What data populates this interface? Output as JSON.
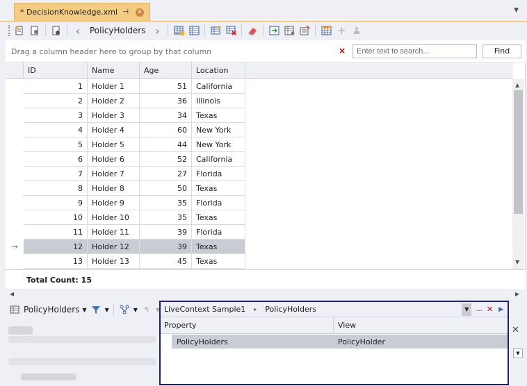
{
  "tab": {
    "title": "* DecisionKnowledge.xml",
    "pin": "⊣",
    "close": "✕",
    "dropdown": "▼"
  },
  "toolbar": {
    "breadcrumb": "PolicyHolders",
    "back": "‹",
    "forward": "›"
  },
  "search": {
    "group_hint": "Drag a column header here to group by that column",
    "placeholder": "Enter text to search...",
    "value": "",
    "clear": "×",
    "find_label": "Find"
  },
  "grid": {
    "columns": [
      "ID",
      "Name",
      "Age",
      "Location"
    ],
    "rows": [
      {
        "id": "1",
        "name": "Holder 1",
        "age": "51",
        "location": "California"
      },
      {
        "id": "2",
        "name": "Holder 2",
        "age": "36",
        "location": "Illinois"
      },
      {
        "id": "3",
        "name": "Holder 3",
        "age": "34",
        "location": "Texas"
      },
      {
        "id": "4",
        "name": "Holder 4",
        "age": "60",
        "location": "New York"
      },
      {
        "id": "5",
        "name": "Holder 5",
        "age": "44",
        "location": "New York"
      },
      {
        "id": "6",
        "name": "Holder 6",
        "age": "52",
        "location": "California"
      },
      {
        "id": "7",
        "name": "Holder 7",
        "age": "27",
        "location": "Florida"
      },
      {
        "id": "8",
        "name": "Holder 8",
        "age": "50",
        "location": "Texas"
      },
      {
        "id": "9",
        "name": "Holder 9",
        "age": "35",
        "location": "Florida"
      },
      {
        "id": "10",
        "name": "Holder 10",
        "age": "35",
        "location": "Texas"
      },
      {
        "id": "11",
        "name": "Holder 11",
        "age": "39",
        "location": "Florida"
      },
      {
        "id": "12",
        "name": "Holder 12",
        "age": "39",
        "location": "Texas",
        "selected": true
      },
      {
        "id": "13",
        "name": "Holder 13",
        "age": "45",
        "location": "Texas"
      }
    ],
    "current_row_indicator": "→",
    "total_count_label": "Total Count: 15"
  },
  "bottom": {
    "combo_label": "PolicyHolders"
  },
  "popup": {
    "path": [
      "LiveContext Sample1",
      "PolicyHolders"
    ],
    "path_separator": "▸",
    "buttons": {
      "dropdown": "▼",
      "more": "...",
      "close": "✕",
      "go": "▶"
    },
    "columns": [
      "Property",
      "View"
    ],
    "row": {
      "property": "PolicyHolders",
      "view": "PolicyHolder"
    }
  },
  "side": {
    "close": "✕"
  },
  "colors": {
    "tab_accent": "#f5cc84",
    "selection": "#c9ccd3",
    "popup_border": "#1d1d7a"
  }
}
